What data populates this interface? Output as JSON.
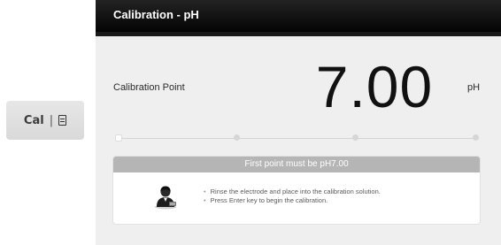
{
  "key": {
    "label": "Cal",
    "separator": "|",
    "icon": "document-icon"
  },
  "screen": {
    "title": "Calibration - pH",
    "point_label": "Calibration Point",
    "value": "7.00",
    "unit": "pH",
    "progress": {
      "total_points": 4,
      "current_point": 1
    },
    "message": {
      "header": "First point must be pH7.00",
      "icon": "operator-icon",
      "instructions": [
        "Rinse the electrode and place into the calibration solution.",
        "Press Enter key to begin the calibration."
      ]
    }
  },
  "colors": {
    "title_bar": "#000000",
    "screen_bg": "#efefef",
    "panel_header": "#b5b5b5",
    "key_bg": "#e0e0e0"
  }
}
